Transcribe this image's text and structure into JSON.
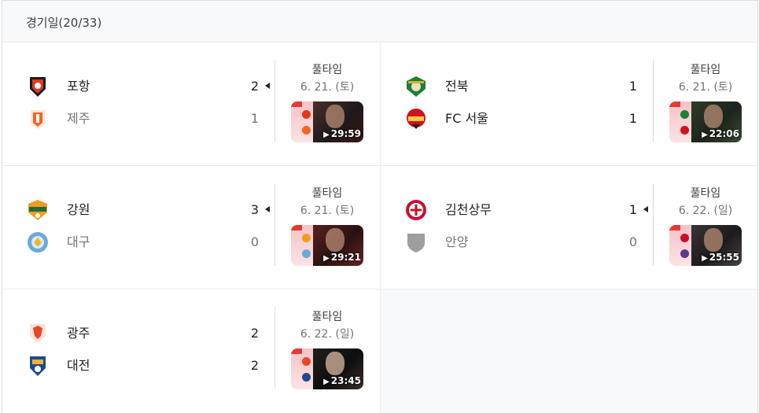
{
  "header": {
    "title": "경기일(20/33)"
  },
  "matches": [
    {
      "home": {
        "name": "포항",
        "score": "2",
        "logo_color": "#e03a1e",
        "winner": true
      },
      "away": {
        "name": "제주",
        "score": "1",
        "logo_color": "#f26522",
        "winner": false
      },
      "status": "풀타임",
      "date": "6. 21. (토)",
      "video": {
        "duration": "29:59"
      }
    },
    {
      "home": {
        "name": "전북",
        "score": "1",
        "logo_color": "#1e7d3a",
        "winner": false
      },
      "away": {
        "name": "FC 서울",
        "score": "1",
        "logo_color": "#d0121b",
        "winner": false
      },
      "status": "풀타임",
      "date": "6. 21. (토)",
      "video": {
        "duration": "22:06"
      }
    },
    {
      "home": {
        "name": "강원",
        "score": "3",
        "logo_color": "#f29c1f",
        "winner": true
      },
      "away": {
        "name": "대구",
        "score": "0",
        "logo_color": "#6aa9d8",
        "winner": false
      },
      "status": "풀타임",
      "date": "6. 21. (토)",
      "video": {
        "duration": "29:21"
      }
    },
    {
      "home": {
        "name": "김천상무",
        "score": "1",
        "logo_color": "#c8102e",
        "winner": true
      },
      "away": {
        "name": "안양",
        "score": "0",
        "logo_color": "#9e9e9e",
        "winner": false
      },
      "status": "풀타임",
      "date": "6. 22. (일)",
      "video": {
        "duration": "25:55"
      }
    },
    {
      "home": {
        "name": "광주",
        "score": "2",
        "logo_color": "#e8452c",
        "winner": false
      },
      "away": {
        "name": "대전",
        "score": "2",
        "logo_color": "#1b4b8f",
        "winner": false
      },
      "status": "풀타임",
      "date": "6. 22. (일)",
      "video": {
        "duration": "23:45"
      }
    }
  ],
  "icons": {
    "play": "play-icon",
    "arrow": "winner-arrow-icon"
  }
}
